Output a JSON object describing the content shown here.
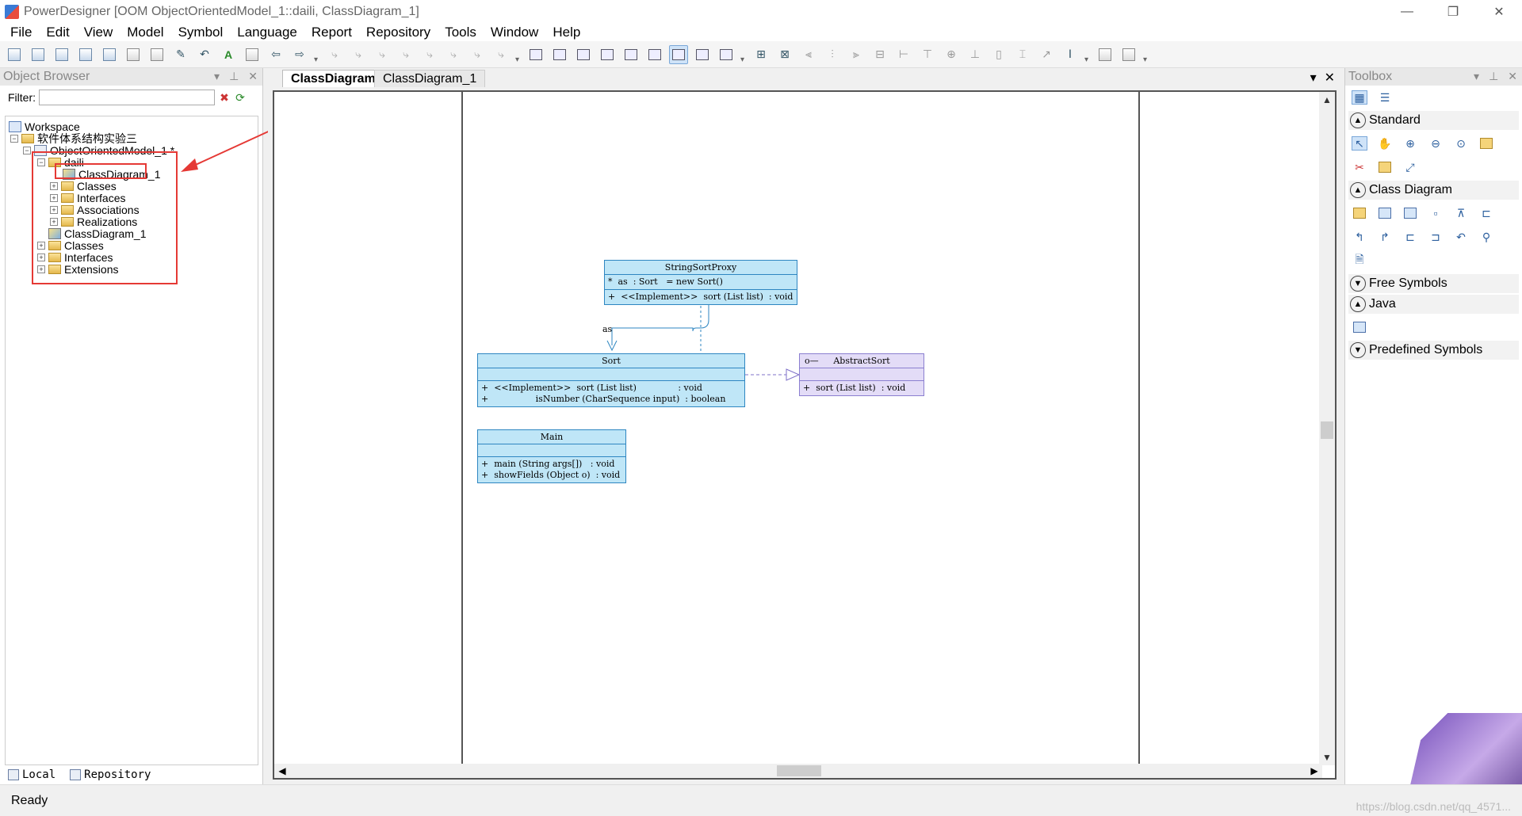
{
  "window": {
    "title": "PowerDesigner [OOM ObjectOrientedModel_1::daili, ClassDiagram_1]",
    "minimize": "—",
    "restore": "❐",
    "close": "✕"
  },
  "menu": [
    "File",
    "Edit",
    "View",
    "Model",
    "Symbol",
    "Language",
    "Report",
    "Repository",
    "Tools",
    "Window",
    "Help"
  ],
  "object_browser": {
    "title": "Object Browser",
    "filter_label": "Filter:",
    "filter_value": "",
    "tree": {
      "workspace": "Workspace",
      "project": "软件体系结构实验三",
      "model": "ObjectOrientedModel_1 *",
      "package": "daili",
      "diagram_in_package": "ClassDiagram_1",
      "pkg_classes": "Classes",
      "pkg_interfaces": "Interfaces",
      "pkg_associations": "Associations",
      "pkg_realizations": "Realizations",
      "model_diagram": "ClassDiagram_1",
      "model_classes": "Classes",
      "model_interfaces": "Interfaces",
      "model_extensions": "Extensions"
    },
    "tabs": {
      "local": "Local",
      "repository": "Repository"
    }
  },
  "editor": {
    "tabs": [
      "ClassDiagram_1",
      "ClassDiagram_1"
    ],
    "active_tab": 0
  },
  "diagram": {
    "proxy": {
      "name": "StringSortProxy",
      "attr": "*  as  : Sort   = new Sort()",
      "op": "+  <<Implement>>  sort (List list)  : void"
    },
    "sort": {
      "name": "Sort",
      "op1": "+  <<Implement>>  sort (List list)               : void",
      "op2": "+                 isNumber (CharSequence input)  : boolean"
    },
    "abstract": {
      "name": "AbstractSort",
      "op": "+  sort (List list)  : void",
      "marker": "o—"
    },
    "main": {
      "name": "Main",
      "op1": "+  main (String args[])   : void",
      "op2": "+  showFields (Object o)  : void"
    },
    "assoc_label": "as"
  },
  "toolbox": {
    "title": "Toolbox",
    "sections": {
      "standard": "Standard",
      "class_diagram": "Class Diagram",
      "free_symbols": "Free Symbols",
      "java": "Java",
      "predefined": "Predefined Symbols"
    }
  },
  "status": {
    "text": "Ready",
    "watermark": "https://blog.csdn.net/qq_4571..."
  },
  "colors": {
    "class_fill": "#bfe6f7",
    "class_border": "#2e86c1",
    "interface_fill": "#e3dcf7",
    "highlight": "#e53935"
  }
}
